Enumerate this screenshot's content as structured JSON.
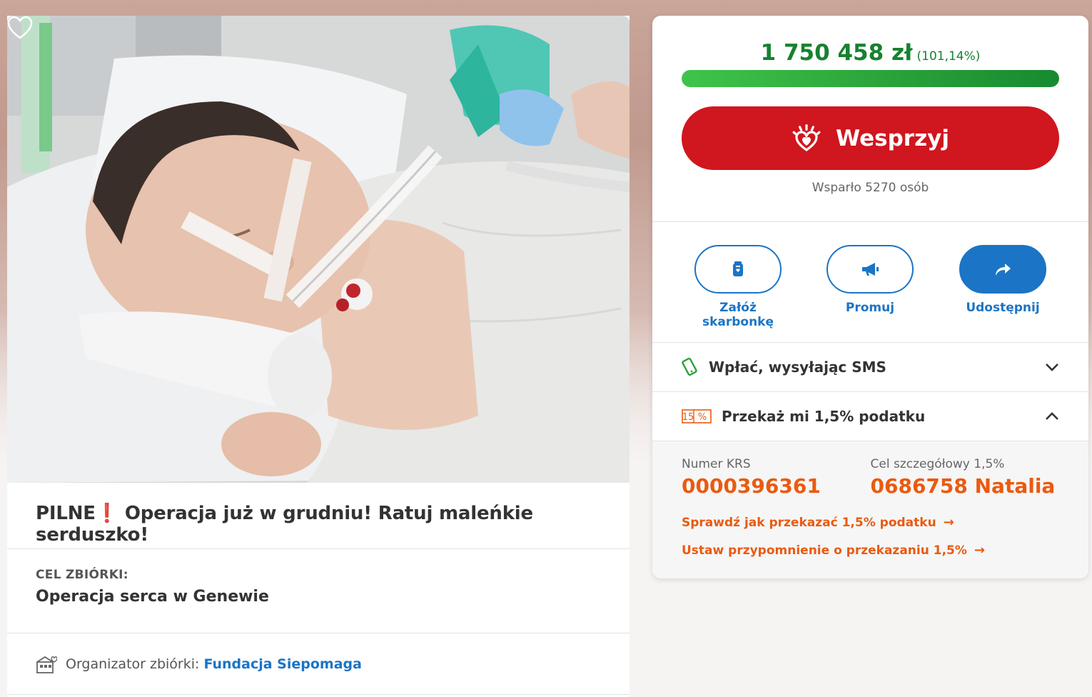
{
  "campaign": {
    "title": "PILNE❗ Operacja już w grudniu! Ratuj maleńkie serduszko!",
    "goal_label": "CEL ZBIÓRKI:",
    "goal_value": "Operacja serca w Genewie",
    "organizer_label": "Organizator zbiórki:",
    "organizer_name": "Fundacja Siepomaga"
  },
  "donation": {
    "amount": "1 750 458 zł",
    "percent": "(101,14%)",
    "progress_fraction": 1.0,
    "support_button": "Wesprzyj",
    "supporters_text": "Wsparło 5270 osób"
  },
  "actions": [
    {
      "label": "Załóż skarbonkę",
      "icon": "piggy-bank-icon"
    },
    {
      "label": "Promuj",
      "icon": "megaphone-icon"
    },
    {
      "label": "Udostępnij",
      "icon": "share-icon"
    }
  ],
  "accordion": {
    "sms_label": "Wpłać, wysyłając SMS",
    "tax_label": "Przekaż mi 1,5% podatku",
    "tax_badge": "1,5%"
  },
  "tax": {
    "krs_label": "Numer KRS",
    "krs_value": "0000396361",
    "goal_label": "Cel szczegółowy 1,5%",
    "goal_value": "0686758 Natalia",
    "link_check": "Sprawdź jak przekazać 1,5% podatku",
    "link_reminder": "Ustaw przypomnienie o przekazaniu 1,5%"
  },
  "colors": {
    "brand_red": "#d0161e",
    "progress_green": "#2aa33a",
    "link_blue": "#1b74c5",
    "tax_orange": "#ea5a10"
  }
}
